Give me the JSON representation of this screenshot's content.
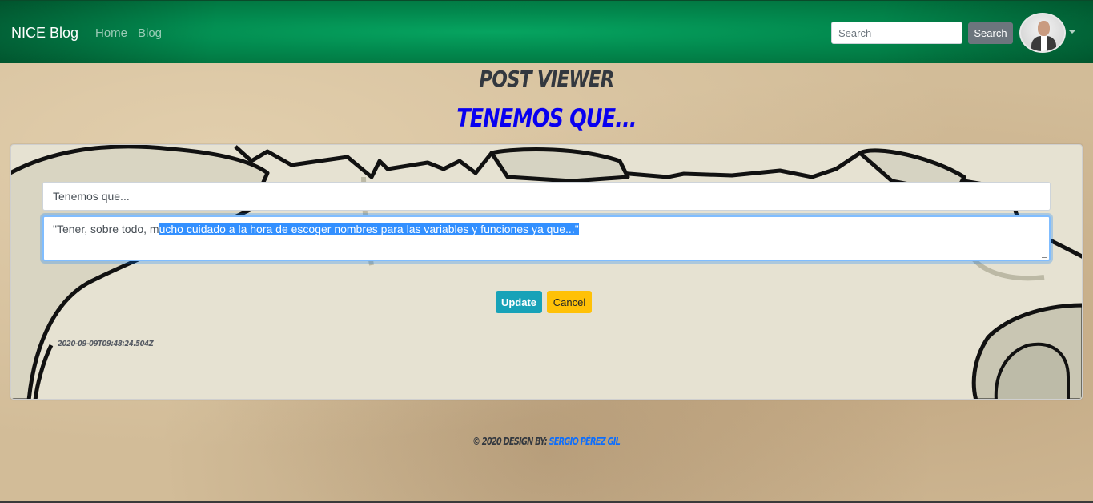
{
  "navbar": {
    "brand": "NICE Blog",
    "links": [
      "Home",
      "Blog"
    ],
    "search_placeholder": "Search",
    "search_button": "Search",
    "colors": {
      "bg": "#02894e",
      "search_btn": "#6c757d"
    }
  },
  "page": {
    "heading": "POST VIEWER",
    "post_title": "TENEMOS QUE..."
  },
  "editor": {
    "title_value": "Tenemos que...",
    "content_prefix": "\"Tener, sobre todo, m",
    "content_selected": "ucho cuidado a la hora de escoger nombres para las variables y funciones ya que...\"",
    "update_label": "Update",
    "cancel_label": "Cancel",
    "timestamp": "2020-09-09T09:48:24.504Z",
    "colors": {
      "update": "#17a2b8",
      "cancel": "#ffc107",
      "focus": "#80bdff"
    }
  },
  "footer": {
    "prefix": "© 2020 DESIGN BY:",
    "author": "SERGIO PÉREZ GIL"
  }
}
